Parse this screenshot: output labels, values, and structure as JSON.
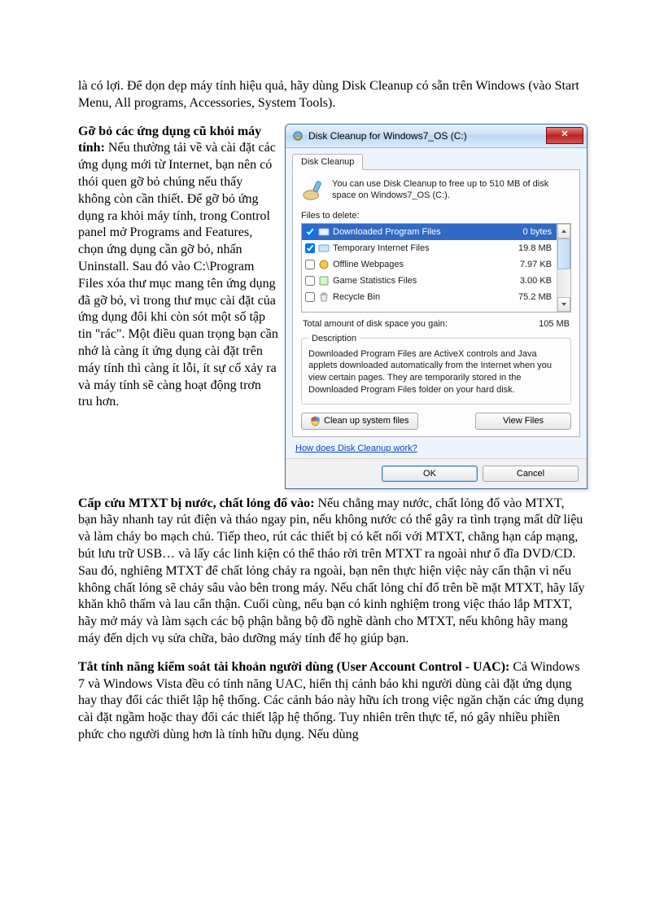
{
  "para1": "là có lợi. Để dọn dẹp máy tính hiệu quả, hãy dùng Disk Cleanup có sẵn trên Windows (vào Start Menu, All programs, Accessories, System Tools).",
  "para2_lead": "Gỡ bỏ các ứng dụng cũ khỏi máy tính:",
  "para2_body": " Nếu thường tải về và cài đặt các ứng dụng mới từ Internet, bạn nên có thói quen gỡ bỏ chúng nếu thấy không còn cần thiết. Để gỡ bỏ ứng dụng ra khỏi máy tính, trong Control panel mở Programs and Features, chọn ứng dụng cần gỡ bỏ, nhấn Uninstall. Sau đó vào C:\\Program Files xóa thư mục mang tên ứng dụng đã gỡ bỏ, vì trong thư mục cài đặt của ứng dụng đôi khi còn sót một số tập tin \"rác\". Một điều quan trọng bạn cần nhớ là càng ít ứng dụng cài đặt trên máy tính thì càng ít lỗi,  ít sự cố xảy ra và máy tính sẽ càng hoạt động trơn tru hơn.",
  "para3_lead": "Cấp cứu MTXT bị nước, chất lỏng đổ vào:",
  "para3_body": " Nếu chẳng may nước, chất lỏng đổ vào MTXT, bạn hãy nhanh tay rút điện và tháo ngay pin, nếu không nước có thể gây ra tình trạng mất dữ liệu và làm cháy bo mạch chủ. Tiếp theo, rút các thiết bị có kết nối với MTXT, chẳng hạn cáp mạng, bút lưu trữ USB… và lấy các linh kiện có thể tháo rời trên MTXT ra ngoài như ổ đĩa DVD/CD. Sau đó, nghiêng MTXT để chất lỏng chảy ra ngoài, bạn nên thực hiện việc này cẩn thận vì nếu không chất lỏng sẽ chảy sâu vào bên trong máy. Nếu chất lỏng chỉ đổ trên bề mặt MTXT, hãy lấy khăn khô thấm và lau cẩn thận. Cuối cùng, nếu bạn có kinh nghiệm trong việc tháo lắp MTXT, hãy mở máy và làm sạch các bộ phận bằng bộ đồ nghề dành cho MTXT, nếu không hãy mang máy đến dịch vụ sửa chữa, bảo dưỡng máy tính để họ giúp bạn.",
  "para4_lead": "Tắt tính năng kiểm soát tài khoản người dùng (User Account Control - UAC):",
  "para4_body": " Cả Windows 7 và Windows Vista đều có tính năng UAC, hiển thị cảnh báo khi người dùng cài đặt ứng dụng hay thay đổi các thiết lập hệ thống. Các cảnh báo này hữu ích trong việc ngăn chặn các ứng dụng cài đặt ngầm hoặc thay đổi các thiết lập hệ thống. Tuy nhiên trên thực tế, nó gây nhiều phiền phức cho người dùng hơn là tính hữu dụng. Nếu dùng",
  "dialog": {
    "title": "Disk Cleanup for Windows7_OS (C:)",
    "tab": "Disk Cleanup",
    "info": "You can use Disk Cleanup to free up to 510 MB of disk space on Windows7_OS (C:).",
    "files_label": "Files to delete:",
    "rows": [
      {
        "checked": true,
        "name": "Downloaded Program Files",
        "size": "0 bytes"
      },
      {
        "checked": true,
        "name": "Temporary Internet Files",
        "size": "19.8 MB"
      },
      {
        "checked": false,
        "name": "Offline Webpages",
        "size": "7.97 KB"
      },
      {
        "checked": false,
        "name": "Game Statistics Files",
        "size": "3.00 KB"
      },
      {
        "checked": false,
        "name": "Recycle Bin",
        "size": "75.2 MB"
      }
    ],
    "total_label": "Total amount of disk space you gain:",
    "total_value": "105 MB",
    "desc_legend": "Description",
    "desc_text": "Downloaded Program Files are ActiveX controls and Java applets downloaded automatically from the Internet when you view certain pages. They are temporarily stored in the Downloaded Program Files folder on your hard disk.",
    "cleanup_btn": "Clean up system files",
    "view_btn": "View Files",
    "help_link": "How does Disk Cleanup work?",
    "ok": "OK",
    "cancel": "Cancel"
  }
}
